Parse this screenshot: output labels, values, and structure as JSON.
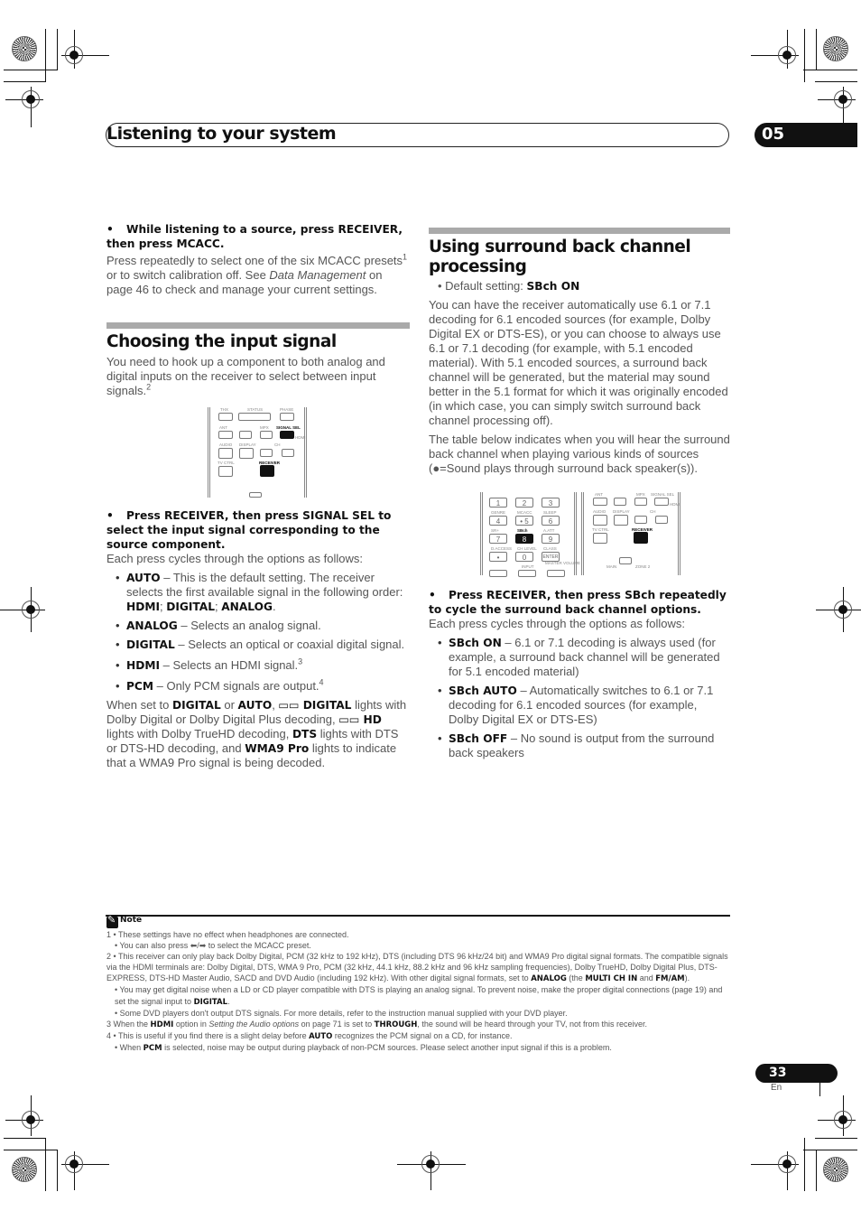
{
  "header": {
    "title": "Listening to your system",
    "chapter": "05"
  },
  "left": {
    "mcacc_step": "While listening to a source, press RECEIVER, then press MCACC.",
    "mcacc_body_1": "Press repeatedly to select one of the six MCACC presets",
    "mcacc_sup": "1",
    "mcacc_body_2": " or to switch calibration off. See ",
    "mcacc_body_link": "Data Management",
    "mcacc_body_3": " on page 46 to check and manage your current settings.",
    "section_title": "Choosing the input signal",
    "intro": "You need to hook up a component to both analog and digital inputs on the receiver to select between input signals.",
    "intro_sup": "2",
    "step": "Press RECEIVER, then press SIGNAL SEL to select the input signal corresponding to the source component.",
    "cycles": "Each press cycles through the options as follows:",
    "options": [
      {
        "name": "AUTO",
        "desc": " – This is the default setting. The receiver selects the first available signal in the following order: ",
        "extra": [
          "HDMI",
          "DIGITAL",
          "ANALOG"
        ]
      },
      {
        "name": "ANALOG",
        "desc": " – Selects an analog signal."
      },
      {
        "name": "DIGITAL",
        "desc": " – Selects an optical or coaxial digital signal."
      },
      {
        "name": "HDMI",
        "desc": " – Selects an HDMI signal.",
        "sup": "3"
      },
      {
        "name": "PCM",
        "desc": " – Only PCM signals are output.",
        "sup": "4"
      }
    ],
    "closing": {
      "p1": "When set to ",
      "b1": "DIGITAL",
      "p2": " or ",
      "b2": "AUTO",
      "p3": ", ",
      "b3": "▭▭ DIGITAL",
      "p4": " lights with Dolby Digital or Dolby Digital Plus decoding, ",
      "b4": "▭▭ HD",
      "p5": " lights with Dolby TrueHD decoding, ",
      "b5": "DTS",
      "p6": " lights with DTS or DTS-HD decoding, and ",
      "b6": "WMA9 Pro",
      "p7": " lights to indicate that a WMA9 Pro signal is being decoded."
    }
  },
  "right": {
    "section_title": "Using surround back channel processing",
    "default_label": "Default setting: ",
    "default_value": "SBch ON",
    "para1": "You can have the receiver automatically use 6.1 or 7.1 decoding for 6.1 encoded sources (for example, Dolby Digital EX or DTS-ES), or you can choose to always use 6.1 or 7.1 decoding (for example, with 5.1 encoded material). With 5.1 encoded sources, a surround back channel will be generated, but the material may sound better in the 5.1 format for which it was originally encoded (in which case, you can simply switch surround back channel processing off).",
    "para2": "The table below indicates when you will hear the surround back channel when playing various kinds of sources (●=Sound plays through surround back speaker(s)).",
    "step": "Press RECEIVER, then press SBch repeatedly to cycle the surround back channel options.",
    "cycles": "Each press cycles through the options as follows:",
    "options": [
      {
        "name": "SBch ON",
        "desc": " – 6.1 or 7.1 decoding is always used (for example, a surround back channel will be generated for 5.1 encoded material)"
      },
      {
        "name": "SBch AUTO",
        "desc": " – Automatically switches to 6.1 or 7.1 decoding for 6.1 encoded sources (for example, Dolby Digital EX or DTS-ES)"
      },
      {
        "name": "SBch OFF",
        "desc": " – No sound is output from the surround back speakers"
      }
    ]
  },
  "remote1": {
    "labels": {
      "thx": "THX",
      "status": "STATUS",
      "phase": "PHASE",
      "ant": "ANT",
      "mpx": "MPX",
      "signal_sel": "SIGNAL SEL",
      "audio": "AUDIO",
      "display": "DISPLAY",
      "ch": "CH",
      "tv_ctrl": "TV CTRL",
      "receiver": "RECEIVER",
      "hdmi": "HDMI"
    }
  },
  "remote2": {
    "keypad": [
      {
        "top": "",
        "key": "1"
      },
      {
        "top": "",
        "key": "2"
      },
      {
        "top": "",
        "key": "3"
      },
      {
        "top": "GENRE",
        "key": "4"
      },
      {
        "top": "MCACC",
        "key": "• 5"
      },
      {
        "top": "SLEEP",
        "key": "6"
      },
      {
        "top": "SR+",
        "key": "7"
      },
      {
        "top": "SBch",
        "key": "8"
      },
      {
        "top": "A.ATT",
        "key": "9"
      },
      {
        "top": "D.ACCESS",
        "key": "•"
      },
      {
        "top": "CH LEVEL",
        "key": "0"
      },
      {
        "top": "CLASS",
        "key": "ENTER"
      }
    ],
    "input": "INPUT",
    "master_volume": "MASTER VOLUME",
    "labels": {
      "ant": "ANT",
      "mpx": "MPX",
      "signal_sel": "SIGNAL SEL",
      "audio": "AUDIO",
      "display": "DISPLAY",
      "ch": "CH",
      "tv_ctrl": "TV CTRL",
      "receiver": "RECEIVER",
      "hdmi": "HDMI",
      "main": "MAIN",
      "zone2": "ZONE 2"
    }
  },
  "notes": {
    "title": "Note",
    "lines": [
      {
        "n": "1",
        "html": "• These settings have no effect when headphones are connected."
      },
      {
        "n": "",
        "html": "• You can also press ⬅/➡ to select the MCACC preset."
      },
      {
        "n": "2",
        "html": "• This receiver can only play back Dolby Digital, PCM (32 kHz to 192 kHz), DTS (including DTS 96 kHz/24 bit) and WMA9 Pro digital signal formats. The compatible signals via the HDMI terminals are: Dolby Digital, DTS, WMA 9 Pro, PCM (32 kHz, 44.1 kHz, 88.2 kHz and 96 kHz sampling frequencies), Dolby TrueHD, Dolby Digital Plus, DTS-EXPRESS, DTS-HD Master Audio, SACD and DVD Audio (including 192 kHz). With other digital signal formats, set to <b>ANALOG</b> (the <b>MULTI CH IN</b> and <b>FM/AM</b>)."
      },
      {
        "n": "",
        "html": "• You may get digital noise when a LD or CD player compatible with DTS is playing an analog signal. To prevent noise, make the proper digital connections (page 19) and set the signal input to <b>DIGITAL</b>."
      },
      {
        "n": "",
        "html": "• Some DVD players don't output DTS signals. For more details, refer to the instruction manual supplied with your DVD player."
      },
      {
        "n": "3",
        "html": "When the <b>HDMI</b> option in <i>Setting the Audio options</i> on page 71 is set to <b>THROUGH</b>, the sound will be heard through your TV, not from this receiver."
      },
      {
        "n": "4",
        "html": "• This is useful if you find there is a slight delay before <b>AUTO</b> recognizes the PCM signal on a CD, for instance."
      },
      {
        "n": "",
        "html": "• When <b>PCM</b> is selected, noise may be output during playback of non-PCM sources. Please select another input signal if this is a problem."
      }
    ]
  },
  "footer": {
    "page_number": "33",
    "language": "En"
  }
}
